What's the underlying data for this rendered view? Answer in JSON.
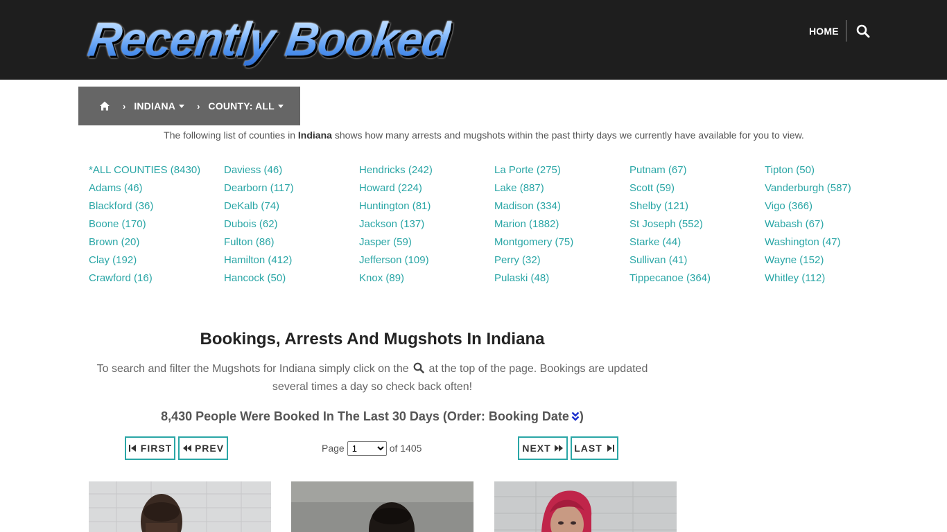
{
  "site": {
    "logo_text": "Recently Booked"
  },
  "nav": {
    "home_label": "HOME",
    "search_icon": "search-icon"
  },
  "breadcrumb": {
    "home_icon": "home-icon",
    "state_label": "INDIANA",
    "county_label": "COUNTY: ALL"
  },
  "intro": {
    "before": "The following list of counties in ",
    "state": "Indiana",
    "after": " shows how many arrests and mugshots within the past thirty days we currently have available for you to view."
  },
  "counties": [
    [
      "*ALL COUNTIES (8430)",
      "Adams (46)",
      "Blackford (36)",
      "Boone (170)",
      "Brown (20)",
      "Clay (192)",
      "Crawford (16)"
    ],
    [
      "Daviess (46)",
      "Dearborn (117)",
      "DeKalb (74)",
      "Dubois (62)",
      "Fulton (86)",
      "Hamilton (412)",
      "Hancock (50)"
    ],
    [
      "Hendricks (242)",
      "Howard (224)",
      "Huntington (81)",
      "Jackson (137)",
      "Jasper (59)",
      "Jefferson (109)",
      "Knox (89)"
    ],
    [
      "La Porte (275)",
      "Lake (887)",
      "Madison (334)",
      "Marion (1882)",
      "Montgomery (75)",
      "Perry (32)",
      "Pulaski (48)"
    ],
    [
      "Putnam (67)",
      "Scott (59)",
      "Shelby (121)",
      "St Joseph (552)",
      "Starke (44)",
      "Sullivan (41)",
      "Tippecanoe (364)"
    ],
    [
      "Tipton (50)",
      "Vanderburgh (587)",
      "Vigo (366)",
      "Wabash (67)",
      "Washington (47)",
      "Wayne (152)",
      "Whitley (112)"
    ]
  ],
  "section": {
    "title": "Bookings, Arrests And Mugshots In Indiana",
    "desc_before": "To search and filter the Mugshots for Indiana simply click on the",
    "desc_after": "at the top of the page. Bookings are updated several times a day so check back often!",
    "booked_text": "8,430 People Were Booked In The Last 30 Days (Order: Booking Date",
    "booked_close": ")"
  },
  "pagination": {
    "first_label": "FIRST",
    "prev_label": "PREV",
    "next_label": "NEXT",
    "last_label": "LAST",
    "page_word": "Page",
    "current_page": "1",
    "of_text": "of 1405"
  },
  "colors": {
    "accent": "#2aa6a6",
    "header_bg": "#1e1e1e",
    "breadcrumb_bg": "#666666"
  }
}
